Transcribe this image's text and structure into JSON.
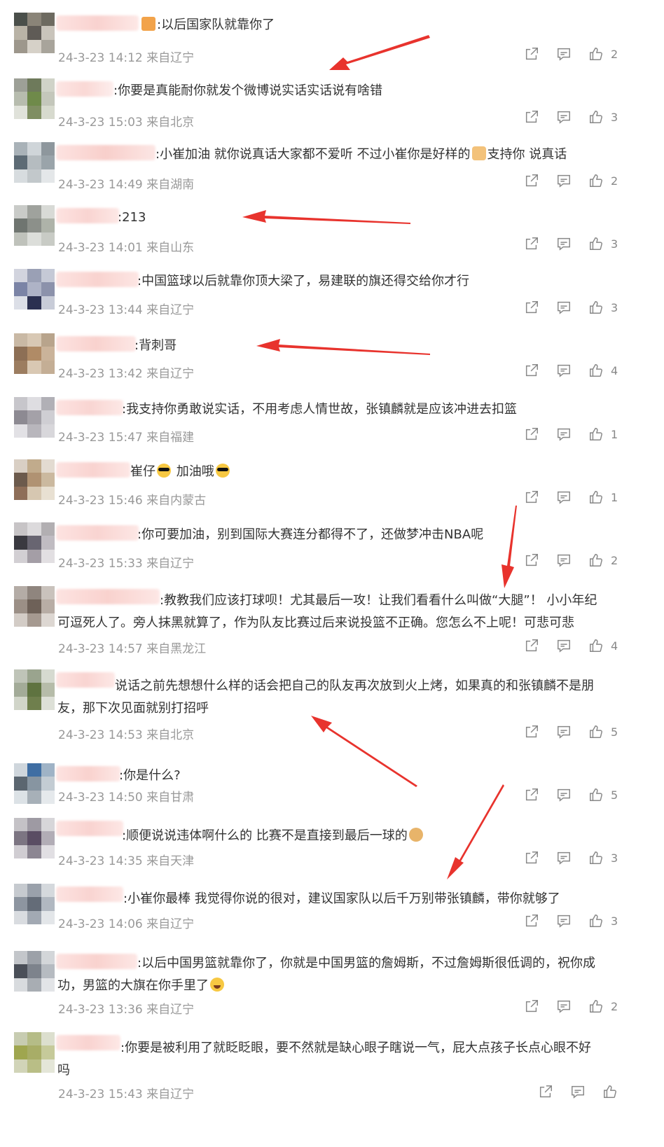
{
  "colors": {
    "text": "#333333",
    "meta": "#999999",
    "icon": "#888888",
    "arrow": "#e8332d"
  },
  "icons": {
    "share": "share-icon",
    "comment": "comment-icon",
    "like": "thumbs-up-icon"
  },
  "comments": [
    {
      "text": ":以后国家队就靠你了",
      "date": "24-3-23 14:12",
      "location": "来自辽宁",
      "likes": "2",
      "emoji_before": "crown"
    },
    {
      "text": ":你要是真能耐你就发个微博说实话实话说有啥错",
      "date": "24-3-23 15:03",
      "location": "来自北京",
      "likes": "3"
    },
    {
      "text": ":小崔加油  就你说真话大家都不爱听 不过小崔你是好样的",
      "text_after": "支持你 说真话",
      "date": "24-3-23 14:49",
      "location": "来自湖南",
      "likes": "2"
    },
    {
      "text": ":213",
      "date": "24-3-23 14:01",
      "location": "来自山东",
      "likes": "3"
    },
    {
      "text": ":中国篮球以后就靠你顶大梁了，易建联的旗还得交给你才行",
      "date": "24-3-23 13:44",
      "location": "来自辽宁",
      "likes": "3"
    },
    {
      "text": ":背刺哥",
      "date": "24-3-23 13:42",
      "location": "来自辽宁",
      "likes": "4"
    },
    {
      "text": ":我支持你勇敢说实话，不用考虑人情世故，张镇麟就是应该冲进去扣篮",
      "date": "24-3-23 15:47",
      "location": "来自福建",
      "likes": "1"
    },
    {
      "text": "崔仔",
      "text_after": " 加油哦",
      "date": "24-3-23 15:46",
      "location": "来自内蒙古",
      "likes": "1"
    },
    {
      "text": ":你可要加油，别到国际大赛连分都得不了，还做梦冲击NBA呢",
      "date": "24-3-23 15:33",
      "location": "来自辽宁",
      "likes": "2"
    },
    {
      "text": ":教教我们应该打球呗！尤其最后一攻！让我们看看什么叫做“大腿”！ 小小年纪",
      "text_line2": "可逗死人了。旁人抹黑就算了，作为队友比赛过后来说投篮不正确。您怎么不上呢！可悲可悲",
      "date": "24-3-23 14:57",
      "location": "来自黑龙江",
      "likes": "4"
    },
    {
      "text": "说话之前先想想什么样的话会把自己的队友再次放到火上烤，如果真的和张镇麟不是朋",
      "text_line2": "友，那下次见面就别打招呼",
      "date": "24-3-23 14:53",
      "location": "来自北京",
      "likes": "5"
    },
    {
      "text": ":你是什么?",
      "date": "24-3-23 14:50",
      "location": "来自甘肃",
      "likes": "5"
    },
    {
      "text": ":顺便说说违体啊什么的 比赛不是直接到最后一球的",
      "date": "24-3-23 14:35",
      "location": "来自天津",
      "likes": "3"
    },
    {
      "text": ":小崔你最棒 我觉得你说的很对，建议国家队以后千万别带张镇麟，带你就够了",
      "date": "24-3-23 14:06",
      "location": "来自辽宁",
      "likes": "3"
    },
    {
      "text": ":以后中国男篮就靠你了，你就是中国男篮的詹姆斯，不过詹姆斯很低调的，祝你成",
      "text_line2": "功，男篮的大旗在你手里了",
      "date": "24-3-23 13:36",
      "location": "来自辽宁",
      "likes": "2"
    },
    {
      "text": ":你要是被利用了就眨眨眼，要不然就是缺心眼子瞎说一气，屁大点孩子长点心眼不好",
      "text_line2": "吗",
      "date": "24-3-23 15:43",
      "location": "来自辽宁",
      "likes": ""
    }
  ]
}
